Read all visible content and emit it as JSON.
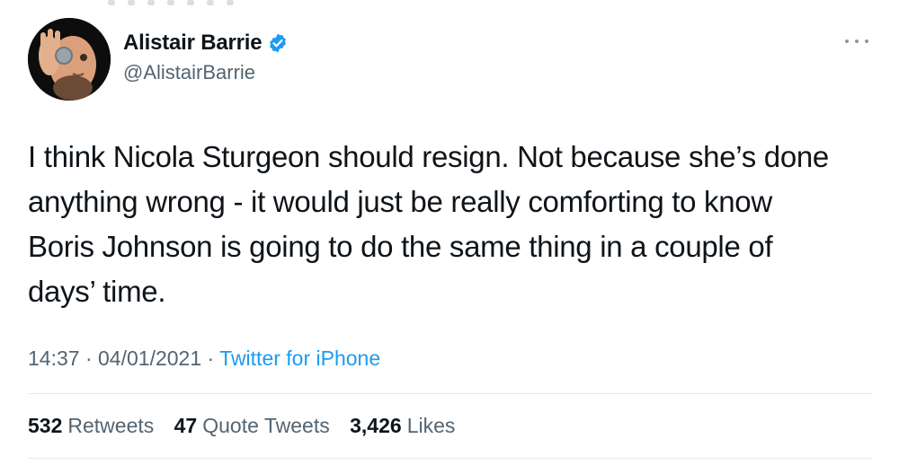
{
  "author": {
    "name": "Alistair Barrie",
    "handle": "@AlistairBarrie",
    "verified": true,
    "verified_color": "#1d9bf0"
  },
  "tweet": {
    "lines": [
      "I think Nicola Sturgeon should resign. Not because she’s done",
      "anything wrong - it would just be really comforting to know",
      "Boris Johnson is going to do the same thing in a couple of",
      "days’ time."
    ],
    "time": "14:37",
    "date": "04/01/2021",
    "source": "Twitter for iPhone"
  },
  "stats": {
    "retweets_count": "532",
    "retweets_label": "Retweets",
    "quotes_count": "47",
    "quotes_label": "Quote Tweets",
    "likes_count": "3,426",
    "likes_label": "Likes"
  },
  "icons": {
    "more": "more-options-icon",
    "verified": "verified-badge-icon"
  },
  "colors": {
    "link": "#1d9bf0",
    "secondary_text": "#536471",
    "primary_text": "#0f1419"
  }
}
